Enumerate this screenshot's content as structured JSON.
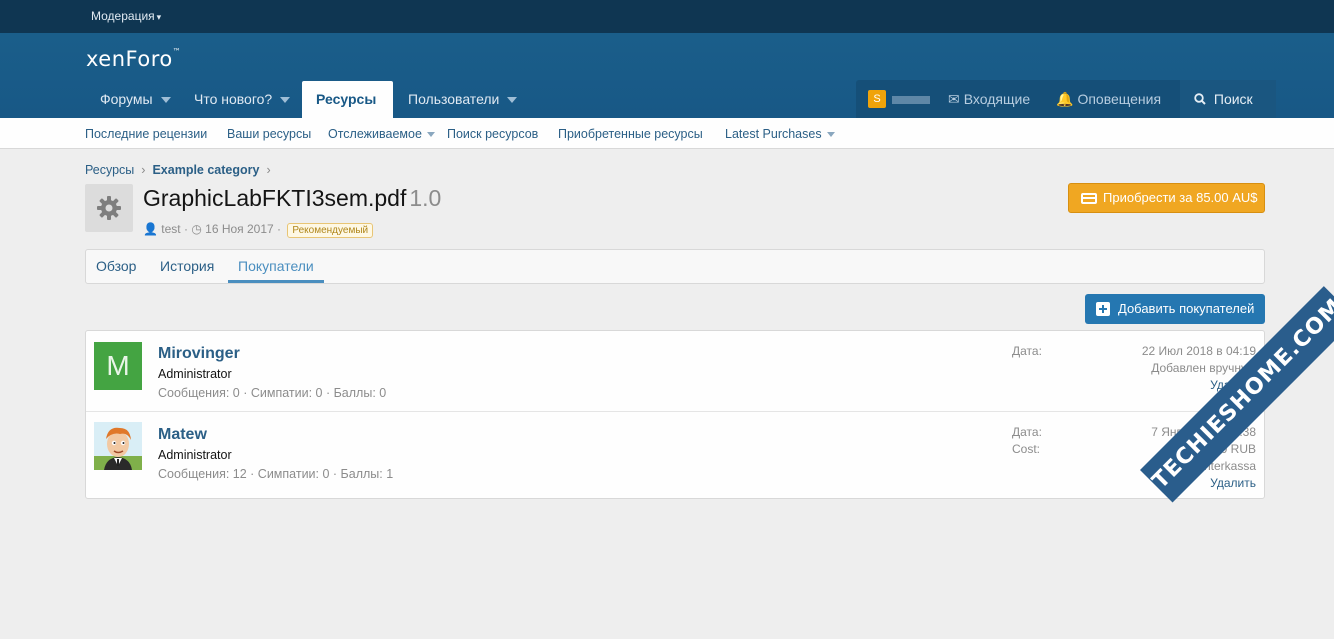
{
  "moderation": {
    "label": "Модерация"
  },
  "logo": {
    "text": "xenForo"
  },
  "nav": {
    "tabs": [
      {
        "label": "Форумы"
      },
      {
        "label": "Что нового?"
      },
      {
        "label": "Ресурсы"
      },
      {
        "label": "Пользователи"
      }
    ],
    "user_avatar_letter": "S",
    "inbox": "Входящие",
    "alerts": "Оповещения",
    "search": "Поиск"
  },
  "subnav": [
    {
      "label": "Последние рецензии"
    },
    {
      "label": "Ваши ресурсы"
    },
    {
      "label": "Отслеживаемое"
    },
    {
      "label": "Поиск ресурсов"
    },
    {
      "label": "Приобретенные ресурсы"
    },
    {
      "label": "Latest Purchases"
    }
  ],
  "breadcrumb": {
    "root": "Ресурсы",
    "category": "Example category"
  },
  "resource": {
    "title": "GraphicLabFKTI3sem.pdf",
    "version": "1.0",
    "author": "test",
    "date": "16 Ноя 2017",
    "featured_badge": "Рекомендуемый",
    "buy_label": "Приобрести за 85.00 AU$"
  },
  "tabs": [
    {
      "label": "Обзор"
    },
    {
      "label": "История"
    },
    {
      "label": "Покупатели"
    }
  ],
  "add_buyers_label": "Добавить покупателей",
  "buyers": [
    {
      "avatar_letter": "M",
      "name": "Mirovinger",
      "role": "Administrator",
      "stats": "Сообщения: 0 · Симпатии: 0 · Баллы: 0",
      "date_label": "Дата:",
      "date": "22 Июл 2018 в 04:19",
      "note": "Добавлен вручную",
      "delete": "Удалить"
    },
    {
      "name": "Matew",
      "role": "Administrator",
      "stats": "Сообщения: 12 · Симпатии: 0 · Баллы: 1",
      "date_label": "Дата:",
      "date": "7 Янв 2018 в 19:38",
      "cost_label": "Cost:",
      "cost": "85.00 RUB",
      "gateway": "Interkassa",
      "delete": "Удалить"
    }
  ],
  "watermark": "TECHIESHOME.COM",
  "colors": {
    "header": "#185886",
    "accent": "#2577b1",
    "buy": "#f0a722",
    "avatar_m": "#44a442"
  }
}
